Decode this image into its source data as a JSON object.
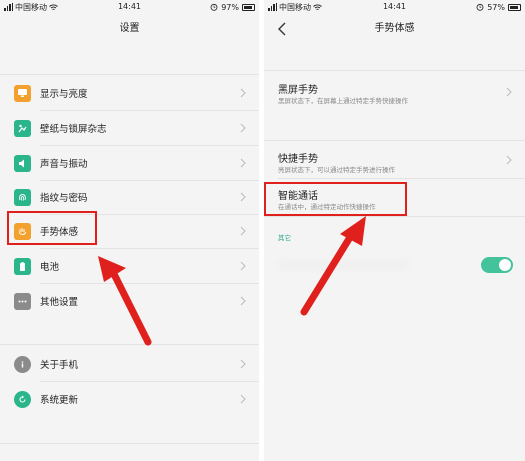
{
  "left_screen": {
    "status": {
      "carrier": "中国移动",
      "time": "14:41",
      "battery": "97%"
    },
    "title": "设置",
    "items": [
      {
        "label": "显示与亮度",
        "icon": "display-icon",
        "color": "#f2a12f"
      },
      {
        "label": "壁纸与锁屏杂志",
        "icon": "wallpaper-icon",
        "color": "#2bb58a"
      },
      {
        "label": "声音与振动",
        "icon": "sound-icon",
        "color": "#2bb58a"
      },
      {
        "label": "指纹与密码",
        "icon": "fingerprint-icon",
        "color": "#2bb58a"
      },
      {
        "label": "手势体感",
        "icon": "gesture-icon",
        "color": "#f2a12f"
      },
      {
        "label": "电池",
        "icon": "battery-icon",
        "color": "#2bb58a"
      },
      {
        "label": "其他设置",
        "icon": "more-icon",
        "color": "#8b8b8b"
      },
      {
        "label": "关于手机",
        "icon": "info-icon",
        "color": "#8b8b8b"
      },
      {
        "label": "系统更新",
        "icon": "update-icon",
        "color": "#2bb58a"
      }
    ]
  },
  "right_screen": {
    "status": {
      "carrier": "中国移动",
      "time": "14:41",
      "battery": "57%"
    },
    "title": "手势体感",
    "items": [
      {
        "title": "黑屏手势",
        "subtitle": "黑屏状态下，在屏幕上通过特定手势快捷操作"
      },
      {
        "title": "快捷手势",
        "subtitle": "亮屏状态下，可以通过特定手势进行操作"
      },
      {
        "title": "智能通话",
        "subtitle": "在通话中，通过特定动作快捷操作"
      }
    ],
    "section_label": "其它",
    "toggle_on": true
  },
  "colors": {
    "accent": "#43c39b",
    "highlight": "#e0201c"
  }
}
